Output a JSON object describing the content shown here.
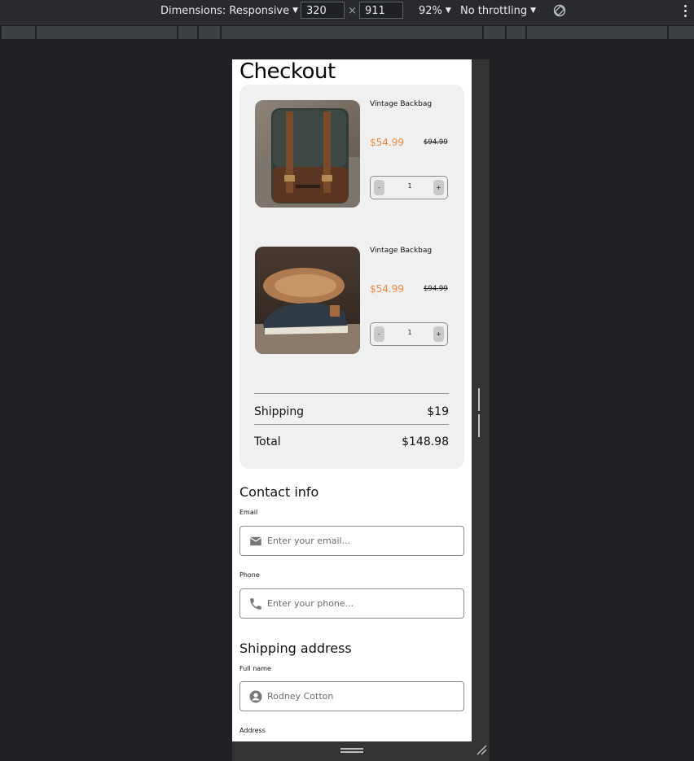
{
  "devtools": {
    "dimensions_label": "Dimensions: Responsive",
    "width_value": "320",
    "times": "×",
    "height_value": "911",
    "zoom": "92%",
    "throttling": "No throttling"
  },
  "page": {
    "title": "Checkout",
    "cart": {
      "items": [
        {
          "name": "Vintage Backbag",
          "price": "$54.99",
          "old_price": "$94.99",
          "qty": "1",
          "minus": "-",
          "plus": "+",
          "image": "backpack"
        },
        {
          "name": "Vintage Backbag",
          "price": "$54.99",
          "old_price": "$94.99",
          "qty": "1",
          "minus": "-",
          "plus": "+",
          "image": "sneakers"
        }
      ],
      "shipping_label": "Shipping",
      "shipping_value": "$19",
      "total_label": "Total",
      "total_value": "$148.98"
    },
    "contact": {
      "title": "Contact info",
      "email_label": "Email",
      "email_placeholder": "Enter your email...",
      "phone_label": "Phone",
      "phone_placeholder": "Enter your phone..."
    },
    "shipping_address": {
      "title": "Shipping address",
      "fullname_label": "Full name",
      "fullname_placeholder": "Rodney Cotton",
      "address_label": "Address"
    }
  },
  "colors": {
    "accent": "#f0883a",
    "cart_bg": "#f0f0f0",
    "devtools_bg": "#202124"
  },
  "icons": [
    "chevron-down-icon",
    "rotate-icon",
    "more-vert-icon",
    "mail-icon",
    "phone-icon",
    "person-icon"
  ]
}
